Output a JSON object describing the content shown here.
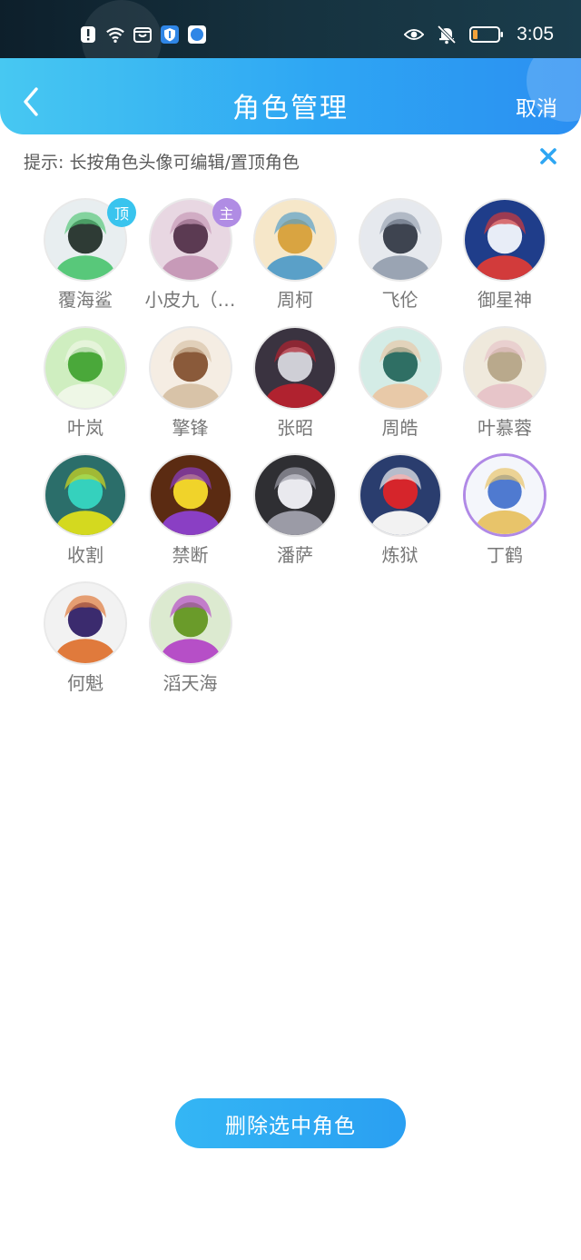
{
  "status_bar": {
    "time": "3:05",
    "left_icons": [
      "alert-icon",
      "wifi-icon",
      "store-icon",
      "shield-icon",
      "compass-app-icon"
    ],
    "right_icons": [
      "eye-icon",
      "bell-muted-icon",
      "battery-icon"
    ]
  },
  "header": {
    "title": "角色管理",
    "cancel_label": "取消"
  },
  "hint": {
    "text": "提示: 长按角色头像可编辑/置顶角色"
  },
  "roles": [
    {
      "name": "覆海鲨",
      "badge": "顶",
      "badge_type": "top",
      "bg": "#e8eef0",
      "fg": "#2e3b35",
      "accent": "#58c87a"
    },
    {
      "name": "小皮九（…",
      "badge": "主",
      "badge_type": "main",
      "bg": "#e8d7e2",
      "fg": "#5b3a52",
      "accent": "#c79ab8"
    },
    {
      "name": "周柯",
      "badge": "",
      "badge_type": "",
      "bg": "#f6e7c9",
      "fg": "#d9a441",
      "accent": "#5aa0c8"
    },
    {
      "name": "飞伦",
      "badge": "",
      "badge_type": "",
      "bg": "#e6e9ee",
      "fg": "#3e4450",
      "accent": "#9aa4b3"
    },
    {
      "name": "御星神",
      "badge": "",
      "badge_type": "",
      "bg": "#1f3d8a",
      "fg": "#e8edf7",
      "accent": "#d23b3b"
    },
    {
      "name": "叶岚",
      "badge": "",
      "badge_type": "",
      "bg": "#cfeec0",
      "fg": "#4aa83a",
      "accent": "#eef7e6"
    },
    {
      "name": "擎锋",
      "badge": "",
      "badge_type": "",
      "bg": "#f5ede3",
      "fg": "#8a5a3a",
      "accent": "#d8c3a8"
    },
    {
      "name": "张昭",
      "badge": "",
      "badge_type": "",
      "bg": "#3a3340",
      "fg": "#cfcfd6",
      "accent": "#b0222f"
    },
    {
      "name": "周皓",
      "badge": "",
      "badge_type": "",
      "bg": "#d4ece6",
      "fg": "#2f6f64",
      "accent": "#e8c9a8"
    },
    {
      "name": "叶慕蓉",
      "badge": "",
      "badge_type": "",
      "bg": "#efe9dc",
      "fg": "#b9a98c",
      "accent": "#e7c5c9"
    },
    {
      "name": "收割",
      "badge": "",
      "badge_type": "",
      "bg": "#2b6e6a",
      "fg": "#35d1bd",
      "accent": "#d4d91f"
    },
    {
      "name": "禁断",
      "badge": "",
      "badge_type": "",
      "bg": "#5b2b12",
      "fg": "#f0d32a",
      "accent": "#8a3fc4"
    },
    {
      "name": "潘萨",
      "badge": "",
      "badge_type": "",
      "bg": "#2f2f33",
      "fg": "#e9e9ee",
      "accent": "#9b9ba6"
    },
    {
      "name": "炼狱",
      "badge": "",
      "badge_type": "",
      "bg": "#2a3d6e",
      "fg": "#d6252b",
      "accent": "#f2f2f2"
    },
    {
      "name": "丁鹤",
      "badge": "",
      "badge_type": "",
      "bg": "#f4f6fb",
      "fg": "#4f7ad0",
      "accent": "#e8c46a",
      "selected": true
    },
    {
      "name": "何魁",
      "badge": "",
      "badge_type": "",
      "bg": "#f2f2f2",
      "fg": "#3b2b6e",
      "accent": "#e07a3c"
    },
    {
      "name": "滔天海",
      "badge": "",
      "badge_type": "",
      "bg": "#dcead0",
      "fg": "#6a9b2a",
      "accent": "#b64fc7"
    }
  ],
  "delete_button": {
    "label": "删除选中角色"
  },
  "colors": {
    "header_start": "#47c8f2",
    "header_end": "#2b8ff2",
    "badge_top": "#39c4ee",
    "badge_main": "#b08ce4",
    "selected_ring": "#b089e6"
  }
}
